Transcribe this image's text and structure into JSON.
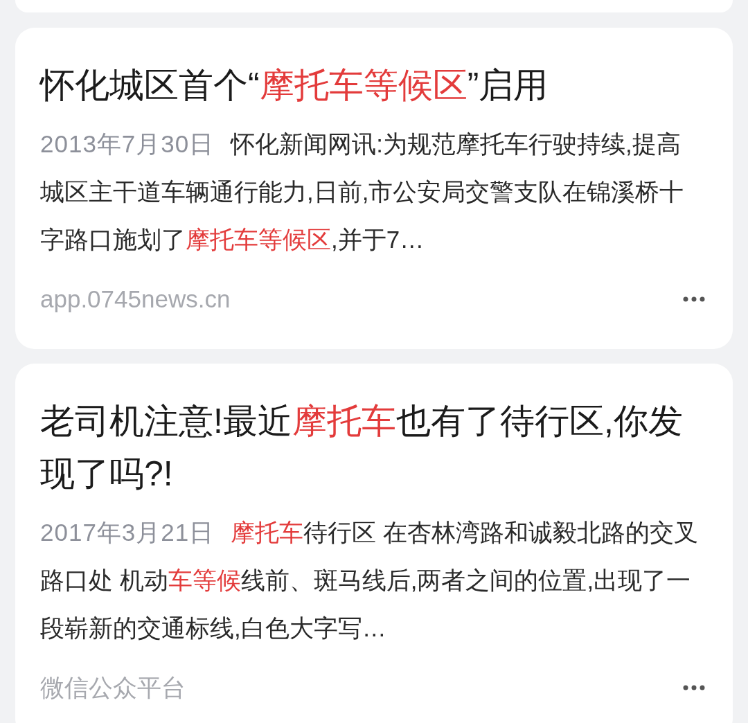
{
  "cards": [
    {
      "title": [
        {
          "text": "怀化城区首个“",
          "highlight": false
        },
        {
          "text": "摩托车等候区",
          "highlight": true
        },
        {
          "text": "”启用",
          "highlight": false
        }
      ],
      "date": "2013年7月30日",
      "snippet": [
        {
          "text": "怀化新闻网讯:为规范摩托车行驶持续,提高城区主干道车辆通行能力,日前,市公安局交警支队在锦溪桥十字路口施划了",
          "highlight": false
        },
        {
          "text": "摩托车等候区",
          "highlight": true
        },
        {
          "text": ",并于7…",
          "highlight": false
        }
      ],
      "source": "app.0745news.cn"
    },
    {
      "title": [
        {
          "text": "老司机注意!最近",
          "highlight": false
        },
        {
          "text": "摩托车",
          "highlight": true
        },
        {
          "text": "也有了待行区,你发现了吗?!",
          "highlight": false
        }
      ],
      "date": "2017年3月21日",
      "snippet": [
        {
          "text": "摩托车",
          "highlight": true
        },
        {
          "text": "待行区 在杏林湾路和诚毅北路的交叉路口处 机动",
          "highlight": false
        },
        {
          "text": "车等候",
          "highlight": true
        },
        {
          "text": "线前、斑马线后,两者之间的位置,出现了一段崭新的交通标线,白色大字写…",
          "highlight": false
        }
      ],
      "source": "微信公众平台"
    }
  ]
}
